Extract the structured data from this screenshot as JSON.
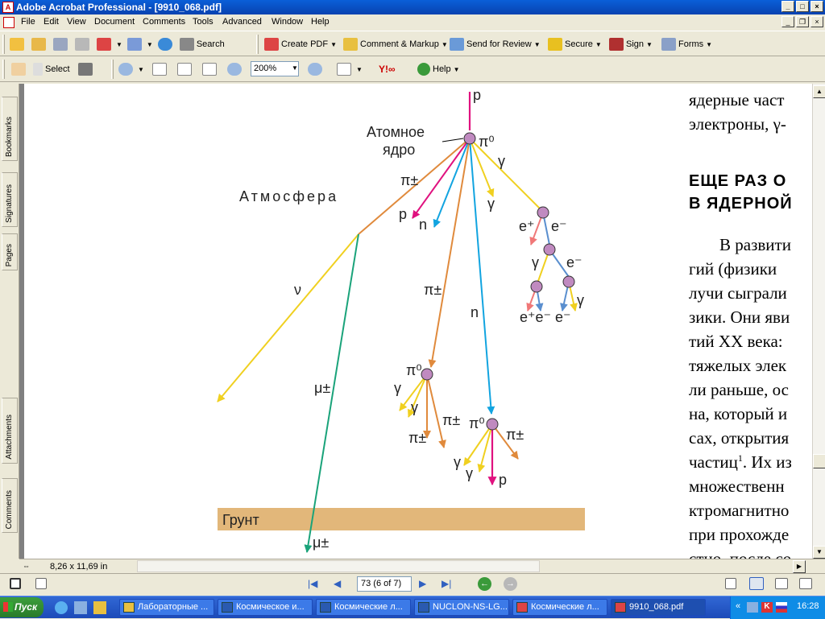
{
  "window": {
    "title": "Adobe Acrobat Professional - [9910_068.pdf]"
  },
  "menu": [
    "File",
    "Edit",
    "View",
    "Document",
    "Comments",
    "Tools",
    "Advanced",
    "Window",
    "Help"
  ],
  "toolbar1": {
    "search": "Search",
    "create_pdf": "Create PDF",
    "comment_markup": "Comment & Markup",
    "send_review": "Send for Review",
    "secure": "Secure",
    "sign": "Sign",
    "forms": "Forms"
  },
  "toolbar2": {
    "select": "Select",
    "zoom": "200%",
    "help": "Help"
  },
  "sidetabs": {
    "bookmarks": "Bookmarks",
    "signatures": "Signatures",
    "pages": "Pages",
    "attachments": "Attachments",
    "comments": "Comments"
  },
  "diagram": {
    "labels": {
      "p_top": "p",
      "nucleus": "Атомное\nядро",
      "pi0_top": "π⁰",
      "atmosphere": "Атмосфера",
      "pipm1": "π±",
      "p_left": "p",
      "n_left": "n",
      "gamma1": "γ",
      "gamma2": "γ",
      "eplus1": "e⁺",
      "eminus1": "e⁻",
      "gamma3": "γ",
      "eminus2": "e⁻",
      "gamma4": "γ",
      "ebottom": "e⁺e⁻ e⁻",
      "nu": "ν",
      "pipm2": "π±",
      "n_mid": "n",
      "mu_mid": "μ±",
      "pi0_mid": "π⁰",
      "gamma5": "γ",
      "gamma6": "γ",
      "pipm3": "π±",
      "pipm4": "π±",
      "pi0_low": "π⁰",
      "pipm5": "π±",
      "gamma7": "γ",
      "gamma8": "γ",
      "p_low": "p",
      "ground": "Грунт",
      "mu_bottom": "μ±"
    }
  },
  "text": {
    "line1": "ядерные част",
    "line2": "электроны, γ-",
    "head1": "ЕЩЕ РАЗ О",
    "head2": "В ЯДЕРНОЙ",
    "p1": "В развити",
    "p2": "гий  (физики",
    "p3": "лучи сыграли",
    "p4": "зики. Они яви",
    "p5": "тий XX века:",
    "p6": "тяжелых элек",
    "p7": "ли раньше, ос",
    "p8": "на, который и",
    "p9": "сах,  открытия",
    "p10": "частиц",
    "p10sup": "1",
    "p10b": ". Их из",
    "p11": "множественн",
    "p12": "ктромагнитно",
    "p13": "при прохожде",
    "p14": "стно, после со"
  },
  "status": {
    "size": "8,26 x 11,69 in"
  },
  "nav": {
    "page": "73  (6 of 7)"
  },
  "taskbar": {
    "start": "Пуск",
    "tasks": [
      "Лабораторные ...",
      "Космическое и...",
      "Космические л...",
      "NUCLON-NS-LG...",
      "Космические л...",
      "9910_068.pdf"
    ],
    "clock": "16:28"
  },
  "colors": {
    "magenta": "#e0127f",
    "cyan": "#12a4e0",
    "orange": "#e08a3c",
    "yellow": "#f0d020",
    "green": "#1aa37a",
    "blue": "#5a8fcf",
    "salmon": "#f07878",
    "vertex": "#c08ac0",
    "ground": "#e2b77a"
  }
}
